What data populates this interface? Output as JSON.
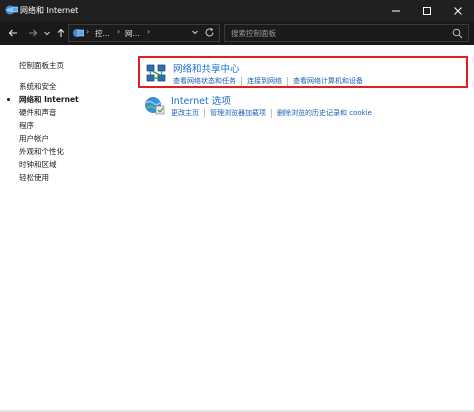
{
  "window": {
    "title": "网络和 Internet",
    "controls": [
      "minimize",
      "maximize",
      "close"
    ]
  },
  "nav": {
    "back_icon": "arrow-left",
    "forward_icon": "arrow-right",
    "recent_icon": "chevron-down",
    "up_icon": "arrow-up",
    "address_segments": [
      "控...",
      "网..."
    ],
    "address_dropdown_icon": "chevron-down",
    "refresh_icon": "refresh",
    "search_placeholder": "搜索控制面板"
  },
  "sidebar": {
    "home": "控制面板主页",
    "items": [
      {
        "label": "系统和安全",
        "active": false
      },
      {
        "label": "网络和 Internet",
        "active": true
      },
      {
        "label": "硬件和声音",
        "active": false
      },
      {
        "label": "程序",
        "active": false
      },
      {
        "label": "用户帐户",
        "active": false
      },
      {
        "label": "外观和个性化",
        "active": false
      },
      {
        "label": "时钟和区域",
        "active": false
      },
      {
        "label": "轻松使用",
        "active": false
      }
    ]
  },
  "categories": [
    {
      "title": "网络和共享中心",
      "icon": "network-sharing-icon",
      "highlighted": true,
      "links": [
        "查看网络状态和任务",
        "连接到网络",
        "查看网络计算机和设备"
      ]
    },
    {
      "title": "Internet 选项",
      "icon": "internet-options-icon",
      "highlighted": false,
      "links": [
        "更改主页",
        "管理浏览器加载项",
        "删除浏览的历史记录和 cookie"
      ]
    }
  ],
  "colors": {
    "titlebar": "#202020",
    "navbar": "#191919",
    "link": "#1a5fb4",
    "category_title": "#1a6fcf",
    "highlight_border": "#e21f1f"
  }
}
